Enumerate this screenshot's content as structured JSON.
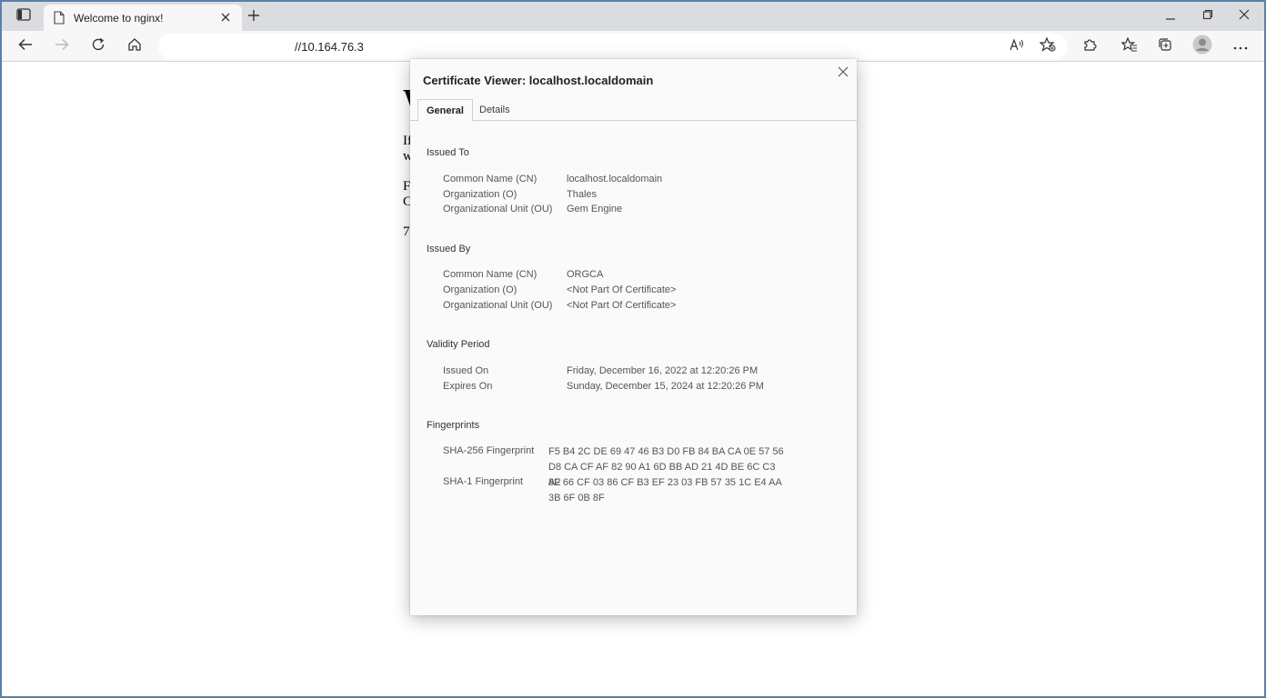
{
  "browser": {
    "tab_title": "Welcome to nginx!",
    "address": "//10.164.76.3"
  },
  "page": {
    "heading": "W",
    "lines": [
      "If",
      "w",
      "F",
      "C",
      "7"
    ]
  },
  "dialog": {
    "title": "Certificate Viewer: localhost.localdomain",
    "tabs": [
      "General",
      "Details"
    ],
    "issued_to": {
      "heading": "Issued To",
      "rows": [
        {
          "label": "Common Name (CN)",
          "value": "localhost.localdomain"
        },
        {
          "label": "Organization (O)",
          "value": "Thales"
        },
        {
          "label": "Organizational Unit (OU)",
          "value": "Gem Engine"
        }
      ]
    },
    "issued_by": {
      "heading": "Issued By",
      "rows": [
        {
          "label": "Common Name (CN)",
          "value": "ORGCA"
        },
        {
          "label": "Organization (O)",
          "value": "<Not Part Of Certificate>"
        },
        {
          "label": "Organizational Unit (OU)",
          "value": "<Not Part Of Certificate>"
        }
      ]
    },
    "validity": {
      "heading": "Validity Period",
      "rows": [
        {
          "label": "Issued On",
          "value": "Friday, December 16, 2022 at 12:20:26 PM"
        },
        {
          "label": "Expires On",
          "value": "Sunday, December 15, 2024 at 12:20:26 PM"
        }
      ]
    },
    "fingerprints": {
      "heading": "Fingerprints",
      "rows": [
        {
          "label": "SHA-256 Fingerprint",
          "line1": "F5 B4 2C DE 69 47 46 B3 D0 FB 84 BA CA 0E 57 56",
          "line2": "D8 CA CF AF 82 90 A1 6D BB AD 21 4D BE 6C C3 A2"
        },
        {
          "label": "SHA-1 Fingerprint",
          "line1": "8F 66 CF 03 86 CF B3 EF 23 03 FB 57 35 1C E4 AA",
          "line2": "3B 6F 0B 8F"
        }
      ]
    }
  }
}
